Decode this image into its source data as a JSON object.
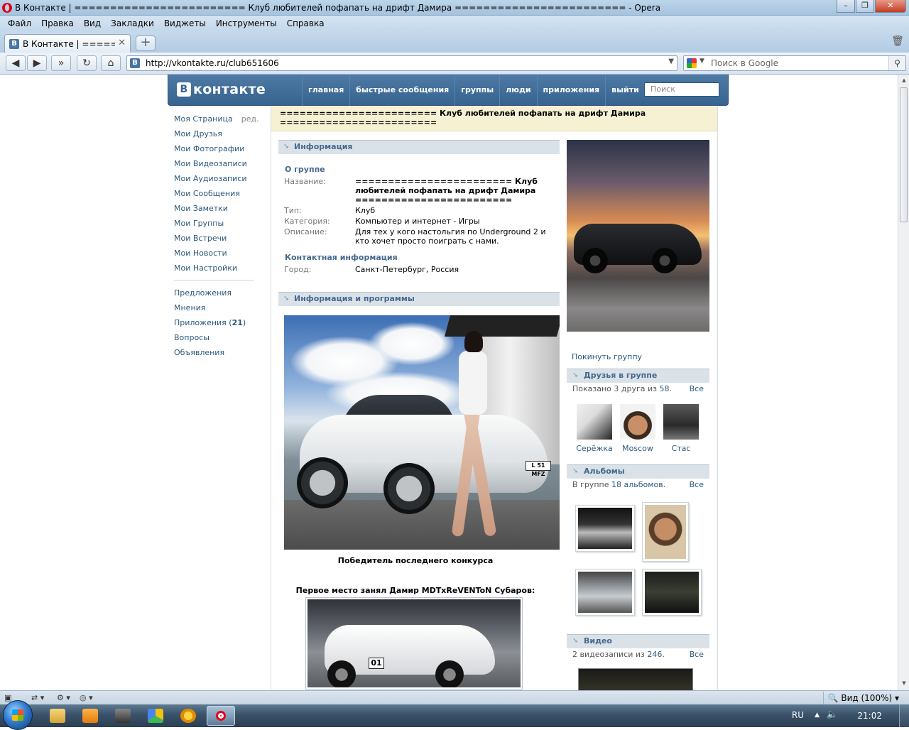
{
  "window": {
    "title": "В Контакте | ======================== Клуб любителей пофапать на дрифт Дамира ======================== - Opera"
  },
  "menu": [
    "Файл",
    "Правка",
    "Вид",
    "Закладки",
    "Виджеты",
    "Инструменты",
    "Справка"
  ],
  "tab": {
    "label": "В Контакте | ======..."
  },
  "address": {
    "url": "http://vkontakte.ru/club651606"
  },
  "search": {
    "placeholder": "Поиск в Google"
  },
  "vk": {
    "logo": "контакте",
    "nav": [
      "главная",
      "быстрые сообщения",
      "группы",
      "люди",
      "приложения",
      "выйти"
    ],
    "search_placeholder": "Поиск",
    "left_menu": {
      "my_page": "Моя Страница",
      "edit": "ред.",
      "items": [
        "Мои Друзья",
        "Мои Фотографии",
        "Мои Видеозаписи",
        "Мои Аудиозаписи",
        "Мои Сообщения",
        "Мои Заметки",
        "Мои Группы",
        "Мои Встречи",
        "Мои Новости",
        "Мои Настройки"
      ],
      "items2": [
        "Предложения",
        "Мнения"
      ],
      "apps_label": "Приложения",
      "apps_count": "21",
      "items3": [
        "Вопросы",
        "Объявления"
      ]
    },
    "group_title": "======================== Клуб любителей пофапать на дрифт Дамира ========================",
    "info": {
      "header": "Информация",
      "about_header": "О группе",
      "name_label": "Название:",
      "name_value": "======================== Клуб любителей пофапать на дрифт Дамира ========================",
      "type_label": "Тип:",
      "type_value": "Клуб",
      "category_label": "Категория:",
      "category_value": "Компьютер и интернет - Игры",
      "desc_label": "Описание:",
      "desc_value": "Для тех у кого настольгия по Underground 2 и кто хочет просто поиграть с нами.",
      "contact_header": "Контактная информация",
      "city_label": "Город:",
      "city_value": "Санкт-Петербург, Россия"
    },
    "programs": {
      "header": "Информация и программы",
      "plate": "L 51 MFZ",
      "caption1": "Победитель последнего конкурса",
      "caption2": "Первое место занял Дамир MDTxReVENToN Субаров:",
      "car_number": "01"
    },
    "right": {
      "leave": "Покинуть группу",
      "friends_header": "Друзья в группе",
      "friends_shown": "Показано 3 друга из",
      "friends_total": "58",
      "all": "Все",
      "friends": [
        "Серёжка",
        "Moscow",
        "Стас"
      ],
      "albums_header": "Альбомы",
      "albums_prefix": "В группе",
      "albums_count": "18 альбомов.",
      "video_header": "Видео",
      "video_prefix": "2 видеозаписи из",
      "video_total": "246."
    }
  },
  "statusbar": {
    "zoom": "Вид (100%)"
  },
  "taskbar": {
    "lang": "RU",
    "clock": "21:02"
  },
  "colors": {
    "vk_blue": "#36638f",
    "link": "#2b587a",
    "title_bg": "#f7f1d3",
    "section_bg": "#dae2e8"
  }
}
